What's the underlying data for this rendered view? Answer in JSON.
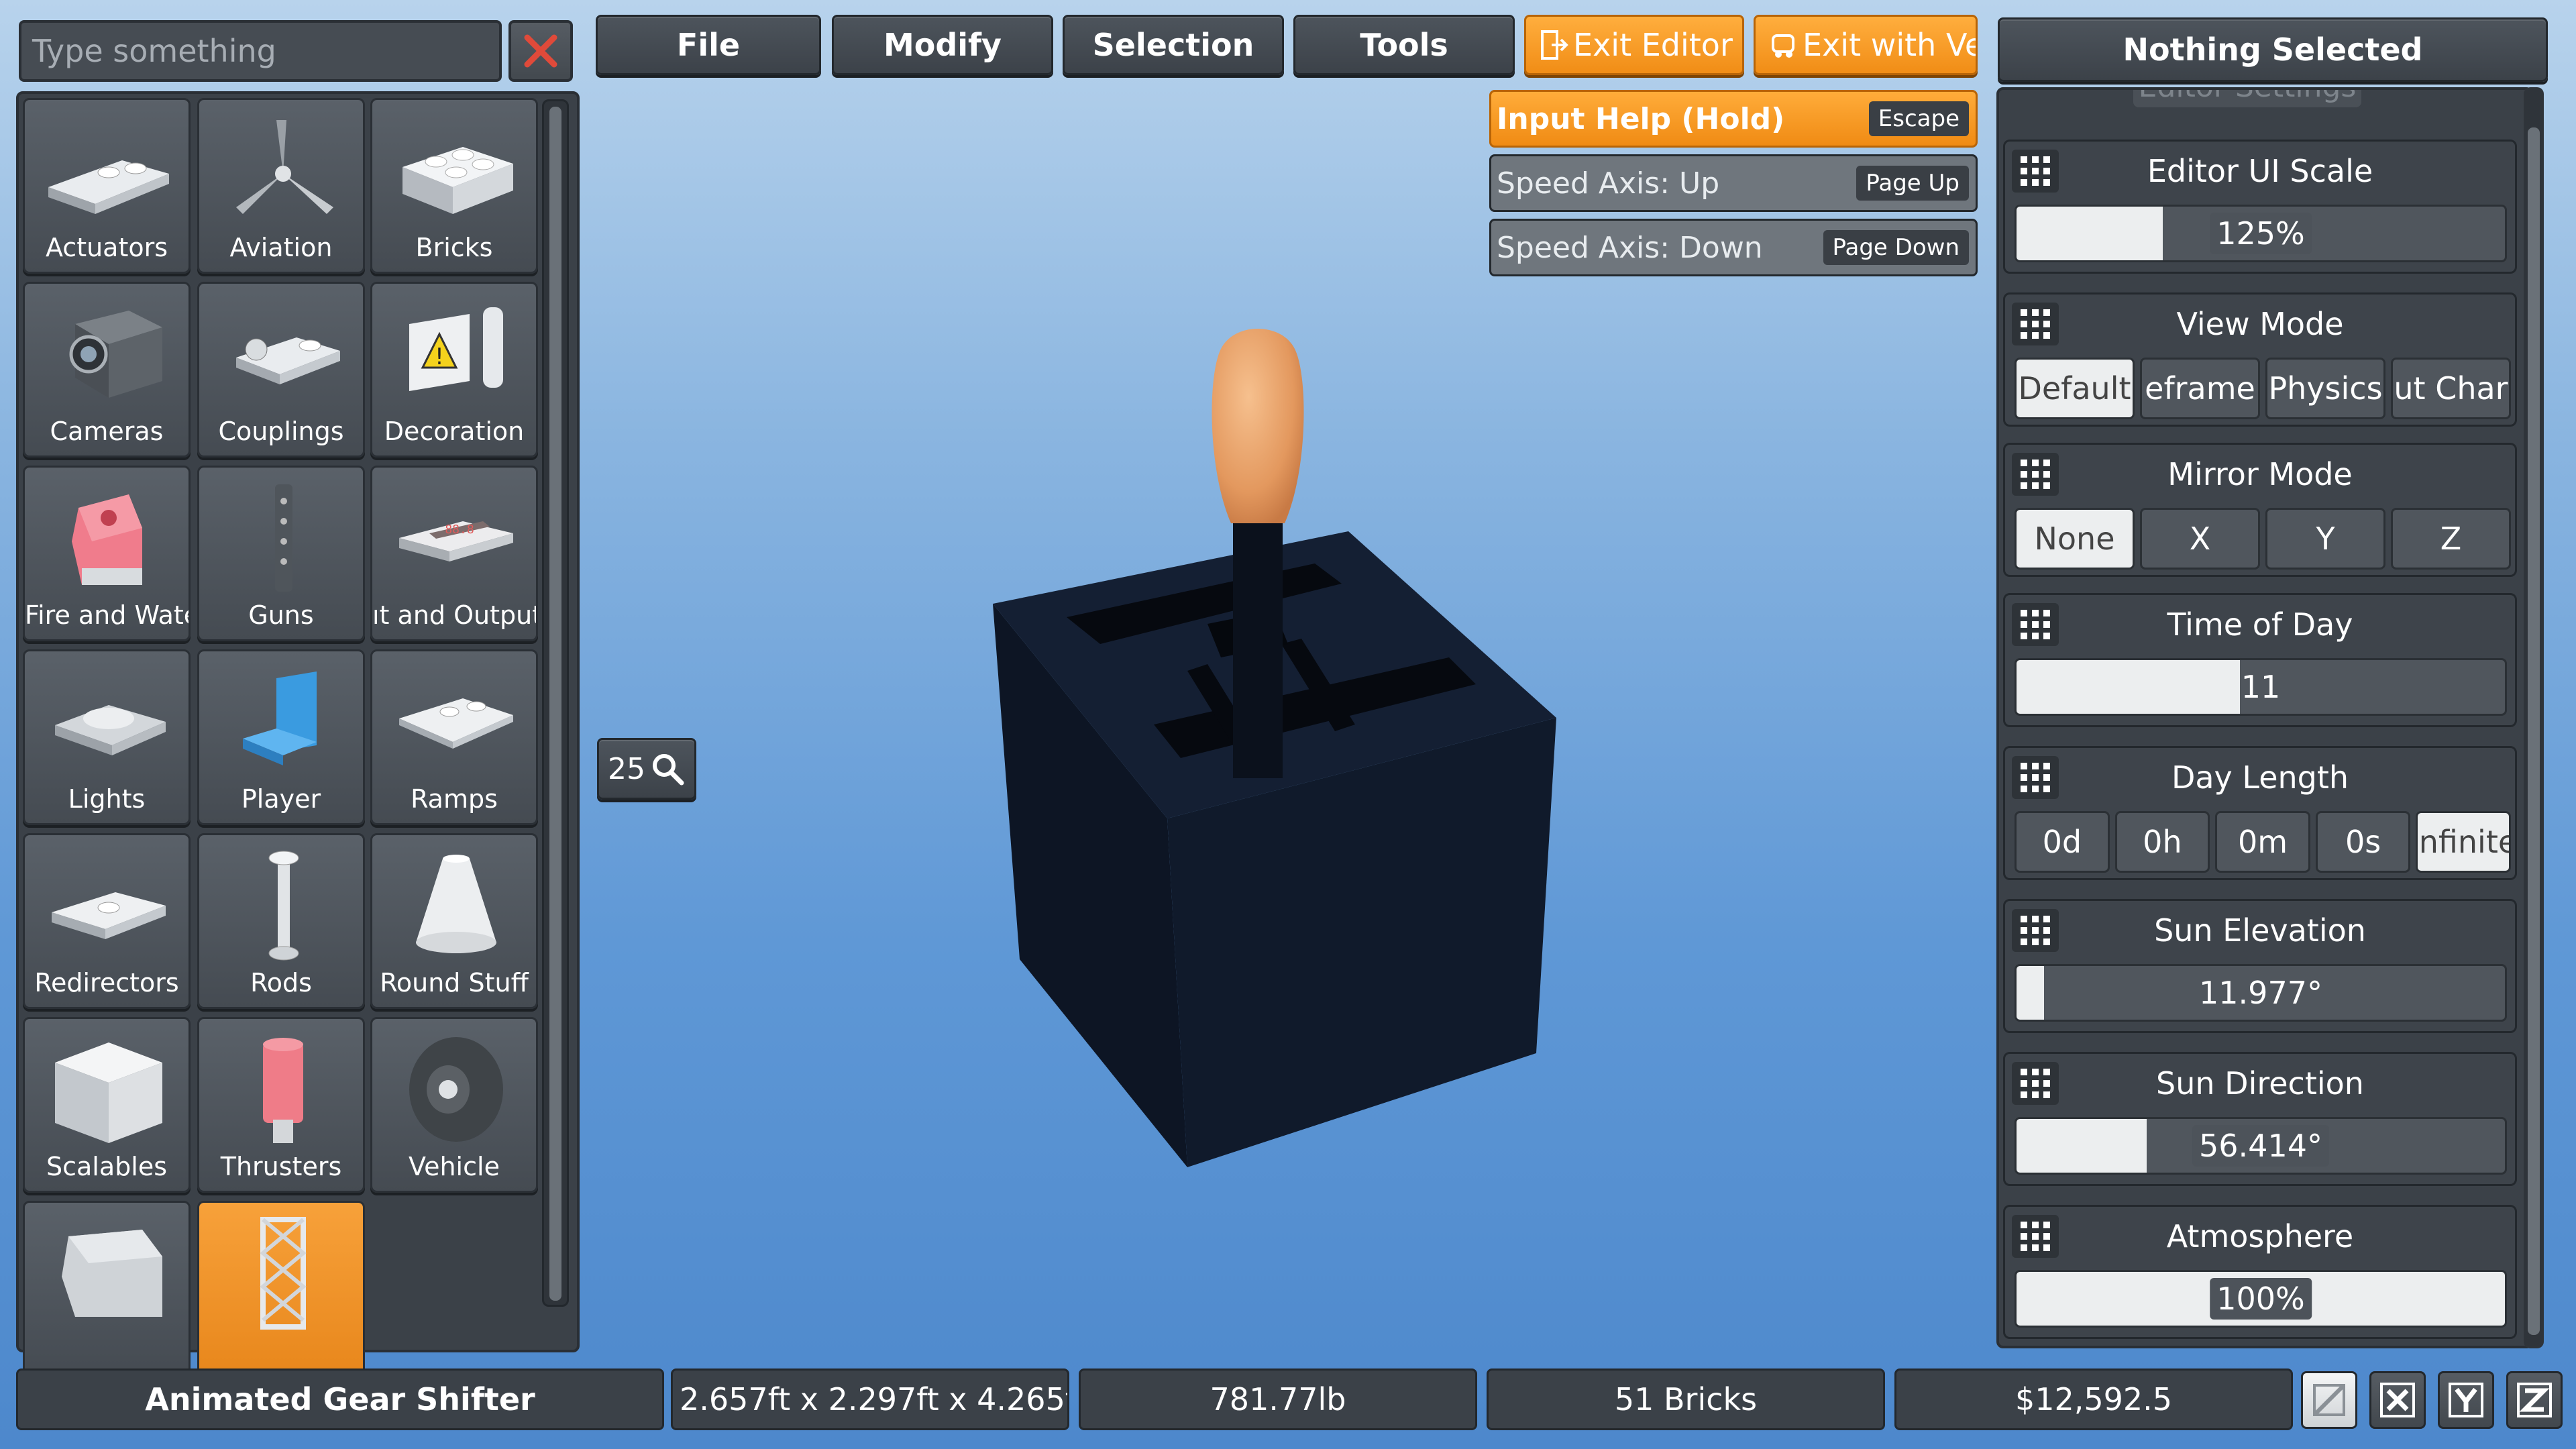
{
  "search": {
    "placeholder": "Type something"
  },
  "categories": [
    {
      "label": "Actuators",
      "icon": "actuator-icon"
    },
    {
      "label": "Aviation",
      "icon": "propeller-icon"
    },
    {
      "label": "Bricks",
      "icon": "brick-icon"
    },
    {
      "label": "Cameras",
      "icon": "camera-icon"
    },
    {
      "label": "Couplings",
      "icon": "coupling-icon"
    },
    {
      "label": "Decoration",
      "icon": "decoration-icon"
    },
    {
      "label": "Fire and Wate",
      "icon": "fire-water-icon"
    },
    {
      "label": "Guns",
      "icon": "gun-icon"
    },
    {
      "label": "ıt and Output",
      "icon": "input-output-icon"
    },
    {
      "label": "Lights",
      "icon": "light-icon"
    },
    {
      "label": "Player",
      "icon": "player-seat-icon"
    },
    {
      "label": "Ramps",
      "icon": "ramp-icon"
    },
    {
      "label": "Redirectors",
      "icon": "redirector-icon"
    },
    {
      "label": "Rods",
      "icon": "rod-icon"
    },
    {
      "label": "Round Stuff",
      "icon": "cone-icon"
    },
    {
      "label": "Scalables",
      "icon": "cube-icon"
    },
    {
      "label": "Thrusters",
      "icon": "thruster-icon"
    },
    {
      "label": "Vehicle",
      "icon": "wheel-icon"
    },
    {
      "label": "",
      "icon": "window-icon"
    },
    {
      "label": "",
      "icon": "truss-icon"
    }
  ],
  "menu": {
    "file": "File",
    "modify": "Modify",
    "selection": "Selection",
    "tools": "Tools",
    "exit_editor": "Exit Editor",
    "exit_with_vehicle": "Exit with Ve"
  },
  "input_help": {
    "title": "Input Help (Hold)",
    "title_key": "Escape",
    "rows": [
      {
        "label": "Speed Axis: Up",
        "key": "Page Up"
      },
      {
        "label": "Speed Axis: Down",
        "key": "Page Down"
      }
    ]
  },
  "zoom": {
    "value": "25"
  },
  "right": {
    "title": "Nothing Selected",
    "hidden_header": "Editor Settings",
    "ui_scale": {
      "title": "Editor UI Scale",
      "value": "125%",
      "fraction": 0.3
    },
    "view_mode": {
      "title": "View Mode",
      "options": [
        "Default",
        "eframe",
        "Physics",
        "ut Char"
      ],
      "selected": 0
    },
    "mirror_mode": {
      "title": "Mirror Mode",
      "options": [
        "None",
        "X",
        "Y",
        "Z"
      ],
      "selected": 0
    },
    "time_of_day": {
      "title": "Time of Day",
      "value": "11",
      "fraction": 0.458
    },
    "day_length": {
      "title": "Day Length",
      "options": [
        "0d",
        "0h",
        "0m",
        "0s",
        "Infinite"
      ],
      "selected": 4
    },
    "sun_elevation": {
      "title": "Sun Elevation",
      "value": "11.977°",
      "fraction": 0.056
    },
    "sun_direction": {
      "title": "Sun Direction",
      "value": "56.414°",
      "fraction": 0.266
    },
    "atmosphere": {
      "title": "Atmosphere",
      "value": "100%",
      "fraction": 1.0
    }
  },
  "status": {
    "name": "Animated Gear Shifter",
    "size": "2.657ft x 2.297ft x 4.265f",
    "weight": "781.77lb",
    "bricks": "51 Bricks",
    "cost": "$12,592.5"
  },
  "axis_buttons": [
    "grid-toggle-icon",
    "x-axis-icon",
    "y-axis-icon",
    "z-axis-icon"
  ],
  "colors": {
    "accent_orange": "#f39a26",
    "panel": "#3b4148",
    "sky_top": "#b8d3ec",
    "sky_bottom": "#4d88cc",
    "knob": "#e8a36a",
    "box": "#0f1828"
  }
}
